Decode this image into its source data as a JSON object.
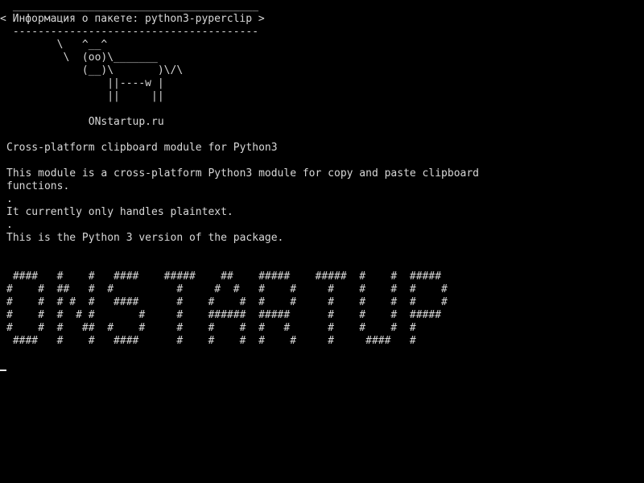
{
  "terminal": {
    "background_color": "#000000",
    "text_color": "#d8d8d8",
    "cowsay": {
      "top_border": " _______________________________________",
      "message": "< Информация о пакете: python3-pyperclip >",
      "bottom_border": " ---------------------------------------",
      "cow": [
        "        \\   ^__^",
        "         \\  (oo)\\_______",
        "            (__)\\       )\\/\\",
        "                ||----w |",
        "                ||     ||"
      ]
    },
    "site_label": "             ONstartup.ru",
    "package": {
      "summary": "Cross-platform clipboard module for Python3",
      "description_lines": [
        "This module is a cross-platform Python3 module for copy and paste clipboard",
        "functions.",
        ".",
        "It currently only handles plaintext.",
        ".",
        "This is the Python 3 version of the package."
      ]
    },
    "figlet_banner": [
      " ####   #    #   ####    #####    ##    #####    #####  #    #  #####",
      "#    #  ##   #  #          #     #  #   #    #     #    #    #  #    #",
      "#    #  # #  #   ####      #    #    #  #    #     #    #    #  #    #",
      "#    #  #  # #       #     #    ######  #####      #    #    #  #####",
      "#    #  #   ##  #    #     #    #    #  #   #      #    #    #  #",
      " ####   #    #   ####      #    #    #  #    #     #     ####   #"
    ]
  }
}
